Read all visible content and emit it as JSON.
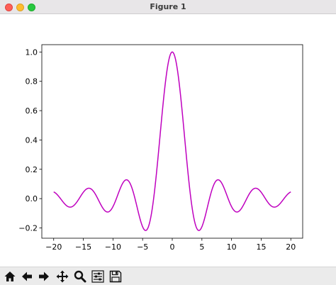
{
  "window": {
    "title": "Figure 1"
  },
  "toolbar": {
    "buttons": [
      {
        "icon": "home-icon",
        "action": "home"
      },
      {
        "icon": "back-arrow-icon",
        "action": "back"
      },
      {
        "icon": "forward-arrow-icon",
        "action": "forward"
      },
      {
        "icon": "pan-move-icon",
        "action": "pan"
      },
      {
        "icon": "zoom-magnifier-icon",
        "action": "zoom"
      },
      {
        "icon": "configure-subplots-icon",
        "action": "configure"
      },
      {
        "icon": "save-floppy-icon",
        "action": "save"
      }
    ]
  },
  "chart_data": {
    "type": "line",
    "title": "",
    "xlabel": "",
    "ylabel": "",
    "xlim": [
      -22,
      22
    ],
    "ylim": [
      -0.27,
      1.05
    ],
    "xticks": [
      -20,
      -15,
      -10,
      -5,
      0,
      5,
      10,
      15,
      20
    ],
    "xtick_labels": [
      "−20",
      "−15",
      "−10",
      "−5",
      "0",
      "5",
      "10",
      "15",
      "20"
    ],
    "yticks": [
      -0.2,
      0.0,
      0.2,
      0.4,
      0.6,
      0.8,
      1.0
    ],
    "ytick_labels": [
      "−0.2",
      "0.0",
      "0.2",
      "0.4",
      "0.6",
      "0.8",
      "1.0"
    ],
    "grid": false,
    "series": [
      {
        "function": "sin(x)/x",
        "x_range": [
          -20,
          20
        ],
        "color": "#bf00bf"
      }
    ]
  }
}
